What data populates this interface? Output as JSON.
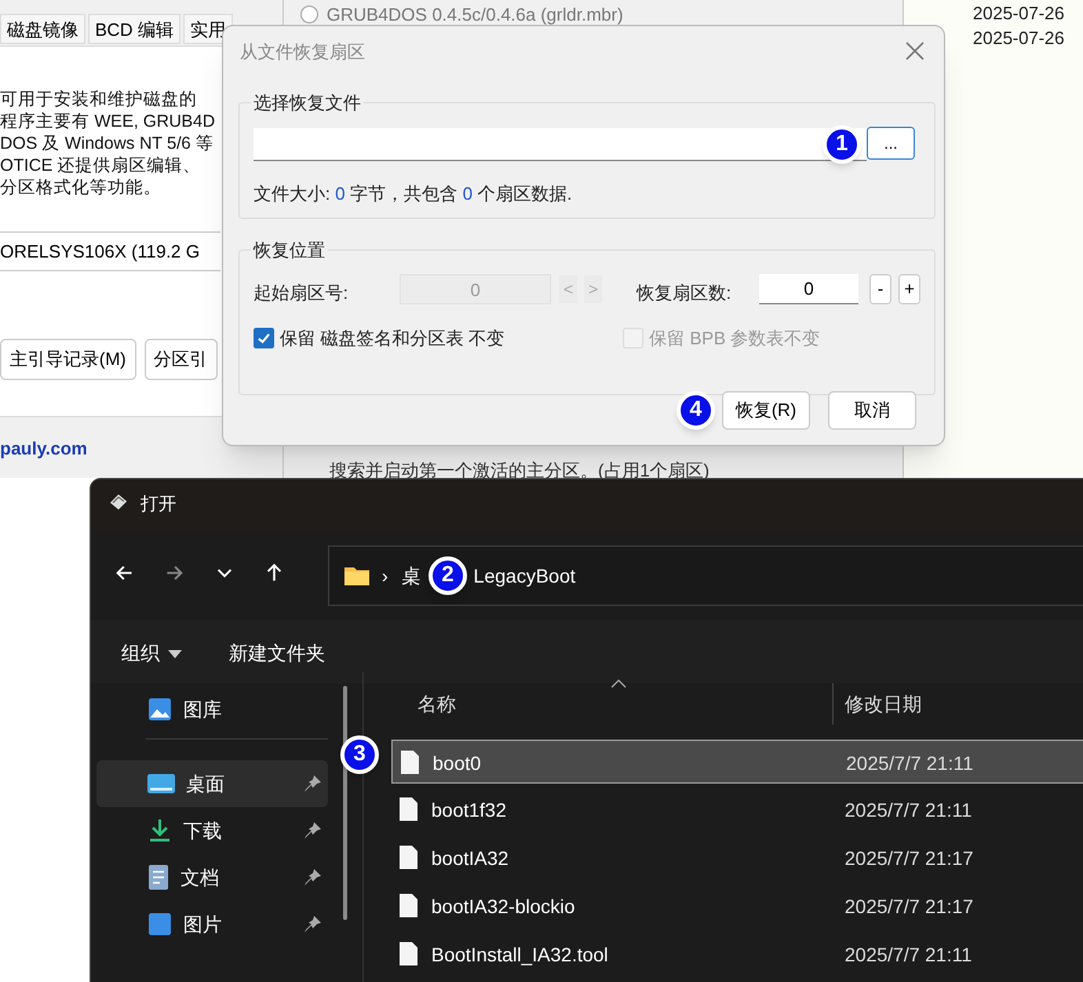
{
  "back_window": {
    "tabs": [
      "磁盘镜像",
      "BCD 编辑",
      "实用"
    ],
    "description": [
      "可用于安装和维护磁盘的",
      "程序主要有 WEE, GRUB4D",
      "DOS 及 Windows NT 5/6 等",
      "OTICE 还提供扇区编辑、",
      "分区格式化等功能。"
    ],
    "disk": "ORELSYS106X (119.2 G",
    "buttons": [
      "主引导记录(M)",
      "分区引"
    ],
    "link": "pauly.com"
  },
  "middle_window": {
    "option_top_checked": false,
    "option_top": "GRUB4DOS 0.4.5c/0.4.6a (grldr.mbr)",
    "option_bottom": "搜索并启动第一个激活的主分区。(占用1个扇区)"
  },
  "right_dates": [
    "2025-07-26",
    "2025-07-26"
  ],
  "restore_dialog": {
    "title": "从文件恢复扇区",
    "file_group": {
      "legend": "选择恢复文件",
      "browse": "...",
      "info": [
        {
          "kind": "text",
          "text": "文件大小: "
        },
        {
          "kind": "number",
          "text": "0"
        },
        {
          "kind": "text",
          "text": " 字节，共包含 "
        },
        {
          "kind": "number",
          "text": "0"
        },
        {
          "kind": "text",
          "text": " 个扇区数据."
        }
      ]
    },
    "position_group": {
      "legend": "恢复位置",
      "start_label": "起始扇区号:",
      "start_value": "0",
      "start_disabled": true,
      "prev": "<",
      "next": ">",
      "count_label": "恢复扇区数:",
      "count_value": "0",
      "minus": "-",
      "plus": "+",
      "options": [
        {
          "label": "保留 磁盘签名和分区表 不变",
          "checked": true,
          "disabled": false
        },
        {
          "label": "保留 BPB 参数表不变",
          "checked": false,
          "disabled": true
        }
      ]
    },
    "buttons": [
      {
        "label": "恢复(R)"
      },
      {
        "label": "取消"
      }
    ]
  },
  "open_dialog": {
    "title": "打开",
    "path_separator": "›",
    "path": [
      "桌",
      "LegacyBoot"
    ],
    "toolbar": [
      {
        "label": "组织",
        "dropdown": true
      },
      {
        "label": "新建文件夹",
        "dropdown": false
      }
    ],
    "sidebar": [
      {
        "label": "图库",
        "kind": "gallery",
        "pinned": false,
        "selected": false
      },
      {
        "kind": "divider"
      },
      {
        "label": "桌面",
        "kind": "desktop",
        "pinned": true,
        "selected": true
      },
      {
        "label": "下载",
        "kind": "download",
        "pinned": true,
        "selected": false
      },
      {
        "label": "文档",
        "kind": "document",
        "pinned": true,
        "selected": false
      },
      {
        "label": "图片",
        "kind": "picture",
        "pinned": true,
        "selected": false
      }
    ],
    "columns": [
      "名称",
      "修改日期"
    ],
    "files": [
      {
        "name": "boot0",
        "date": "2025/7/7 21:11",
        "selected": true
      },
      {
        "name": "boot1f32",
        "date": "2025/7/7 21:11",
        "selected": false
      },
      {
        "name": "bootIA32",
        "date": "2025/7/7 21:17",
        "selected": false
      },
      {
        "name": "bootIA32-blockio",
        "date": "2025/7/7 21:17",
        "selected": false
      },
      {
        "name": "BootInstall_IA32.tool",
        "date": "2025/7/7 21:11",
        "selected": false
      }
    ]
  },
  "callouts": [
    "1",
    "2",
    "3",
    "4"
  ]
}
